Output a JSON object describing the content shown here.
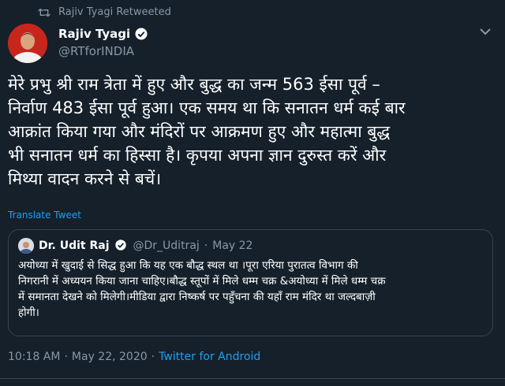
{
  "retweet": {
    "icon": "retweet-icon",
    "label": "Rajiv Tyagi Retweeted"
  },
  "author": {
    "name": "Rajiv Tyagi",
    "handle": "@RTforINDIA",
    "verified": true,
    "avatar_color": "#c7261d"
  },
  "tweet": {
    "text": "मेरे प्रभु श्री राम त्रेता में हुए और बुद्ध का जन्म 563 ईसा पूर्व –\nनिर्वाण 483 ईसा पूर्व हुआ। एक समय था कि सनातन धर्म कई बार\nआक्रांत किया गया और मंदिरों पर आक्रमण हुए और महात्मा बुद्ध\nभी सनातन धर्म का हिस्सा है। कृपया अपना ज्ञान दुरुस्त करें और\nमिथ्या वादन करने से बचें।",
    "translate_label": "Translate Tweet"
  },
  "quoted_tweet": {
    "name": "Dr. Udit Raj",
    "handle": "@Dr_Uditraj",
    "separator": "·",
    "date": "May 22",
    "verified": true,
    "text": "अयोध्या में खुदाई से सिद्ध हुआ कि यह एक बौद्ध स्थल था ।पूरा एरिया पुरातत्व विभाग की\nनिगरानी में अध्ययन किया जाना चाहिए।बौद्ध स्तूपों में मिले धम्म चक्र &अयोध्या में मिले धम्म चक्र\nमें समानता देखने को मिलेगी।मीडिया द्वारा निष्कर्ष पर पहुँचना की यहाँ राम मंदिर था जल्दबाज़ी\nहोगी।"
  },
  "footer": {
    "time": "10:18 AM",
    "separator1": "·",
    "date": "May 22, 2020",
    "separator2": "·",
    "source": "Twitter for Android"
  },
  "colors": {
    "background": "#15202b",
    "muted": "#8899a6",
    "link": "#1da1f2",
    "border": "#38444d"
  }
}
